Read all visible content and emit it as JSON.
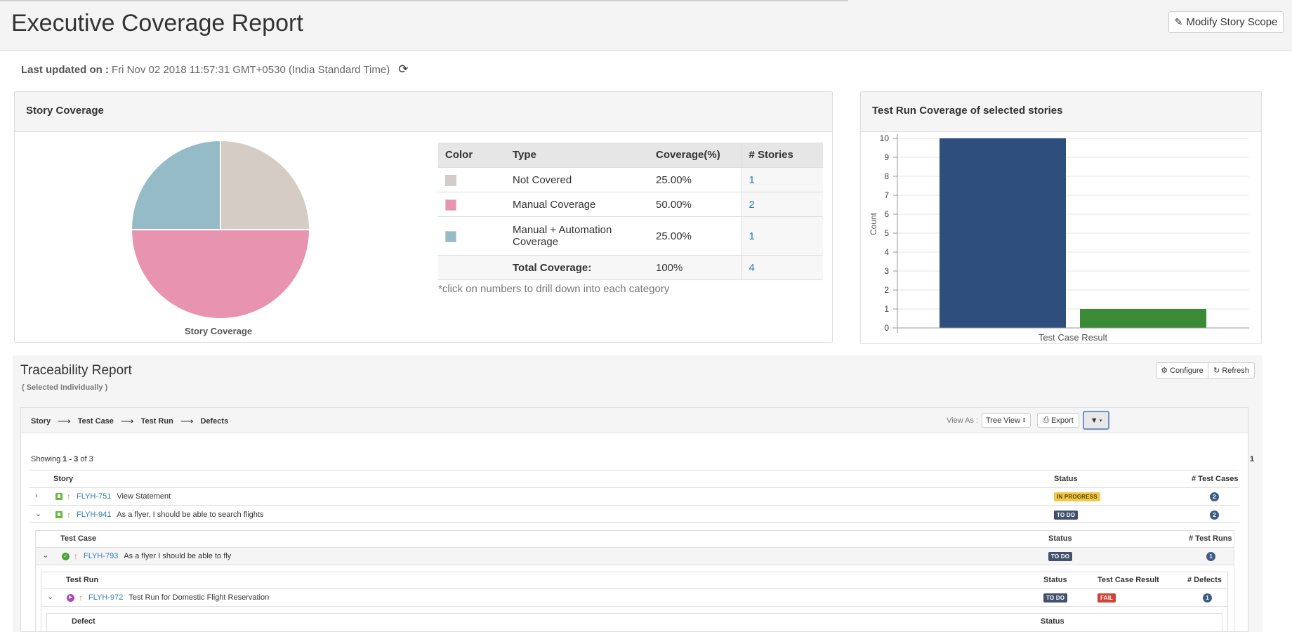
{
  "header": {
    "title": "Executive Coverage Report",
    "modify_button": "Modify Story Scope"
  },
  "last_updated": {
    "label": "Last updated on :",
    "value": "Fri Nov 02 2018 11:57:31 GMT+0530 (India Standard Time)"
  },
  "story_coverage": {
    "title": "Story Coverage",
    "pie_caption": "Story Coverage",
    "table_headers": {
      "color": "Color",
      "type": "Type",
      "coverage": "Coverage(%)",
      "stories": "# Stories"
    },
    "rows": [
      {
        "type": "Not Covered",
        "coverage": "25.00%",
        "stories": "1",
        "color": "#d4ccc5"
      },
      {
        "type": "Manual Coverage",
        "coverage": "50.00%",
        "stories": "2",
        "color": "#e893af"
      },
      {
        "type_line1": "Manual + Automation",
        "type_line2": "Coverage",
        "coverage": "25.00%",
        "stories": "1",
        "color": "#94bbc6"
      }
    ],
    "total": {
      "label": "Total Coverage:",
      "coverage": "100%",
      "stories": "4"
    },
    "note": "*click on numbers to drill down into each category"
  },
  "test_run_coverage": {
    "title": "Test Run Coverage of selected stories"
  },
  "chart_data": {
    "type": "bar",
    "categories": [
      "",
      ""
    ],
    "values": [
      10,
      1
    ],
    "colors": [
      "#2e4e7e",
      "#3b8a35"
    ],
    "title": "",
    "xlabel": "Test Case Result",
    "ylabel": "Count",
    "ylim": [
      0,
      10
    ],
    "yticks": [
      "0",
      "1",
      "2",
      "3",
      "4",
      "5",
      "6",
      "7",
      "8",
      "9",
      "10"
    ],
    "grid": true,
    "legend": "none"
  },
  "traceability": {
    "title": "Traceability Report",
    "subtitle": "( Selected Individually )",
    "configure": "Configure",
    "refresh": "Refresh",
    "flow": [
      "Story",
      "Test Case",
      "Test Run",
      "Defects"
    ],
    "view_as_label": "View As :",
    "view_as_value": "Tree View",
    "export": "Export",
    "showing_prefix": "Showing",
    "showing_range": "1 - 3",
    "showing_suffix": "of 3",
    "page": "1",
    "story_table": {
      "headers": {
        "story": "Story",
        "status": "Status",
        "count": "# Test Cases"
      },
      "rows": [
        {
          "key": "FLYH-751",
          "summary": "View Statement",
          "status": "IN PROGRESS",
          "count": "2"
        },
        {
          "key": "FLYH-941",
          "summary": "As a flyer, I should be able to search flights",
          "status": "TO DO",
          "count": "2"
        }
      ]
    },
    "testcase_table": {
      "headers": {
        "testcase": "Test Case",
        "status": "Status",
        "count": "# Test Runs"
      },
      "row": {
        "key": "FLYH-793",
        "summary": "As a flyer I should be able to fly",
        "status": "TO DO",
        "count": "1"
      }
    },
    "testrun_table": {
      "headers": {
        "testrun": "Test Run",
        "status": "Status",
        "result": "Test Case Result",
        "count": "# Defects"
      },
      "row": {
        "key": "FLYH-972",
        "summary": "Test Run for Domestic Flight Reservation",
        "status": "TO DO",
        "result": "FAIL",
        "count": "1"
      }
    },
    "defect_table": {
      "headers": {
        "defect": "Defect",
        "status": "Status"
      }
    }
  }
}
